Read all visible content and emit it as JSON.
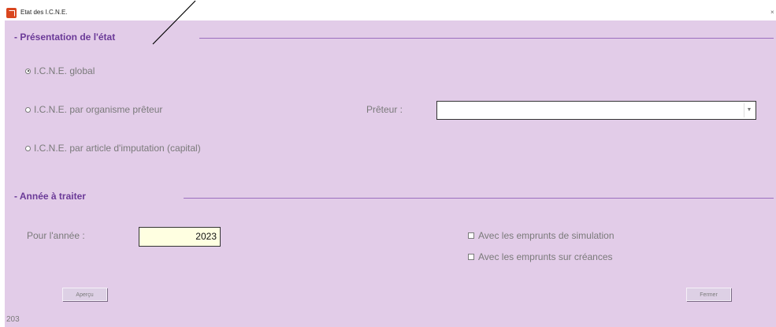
{
  "window": {
    "title": "Etat des I.C.N.E."
  },
  "presentation": {
    "title": "- Présentation de l'état",
    "options": [
      {
        "label": "I.C.N.E. global",
        "checked": true
      },
      {
        "label": "I.C.N.E. par organisme prêteur",
        "checked": false
      },
      {
        "label": "I.C.N.E. par article d'imputation (capital)",
        "checked": false
      }
    ],
    "preteur_label": "Prêteur :",
    "preteur_value": ""
  },
  "annee": {
    "title": "- Année à traiter",
    "label": "Pour l'année :",
    "value": "2023",
    "check_simulation": "Avec les emprunts de simulation",
    "check_creances": "Avec les emprunts sur créances"
  },
  "buttons": {
    "apercu": "Aperçu",
    "fermer": "Fermer"
  },
  "status": {
    "code": "203"
  },
  "colors": {
    "background": "#e2cce8",
    "accent": "#6b3a98",
    "field": "#ffffe1"
  }
}
